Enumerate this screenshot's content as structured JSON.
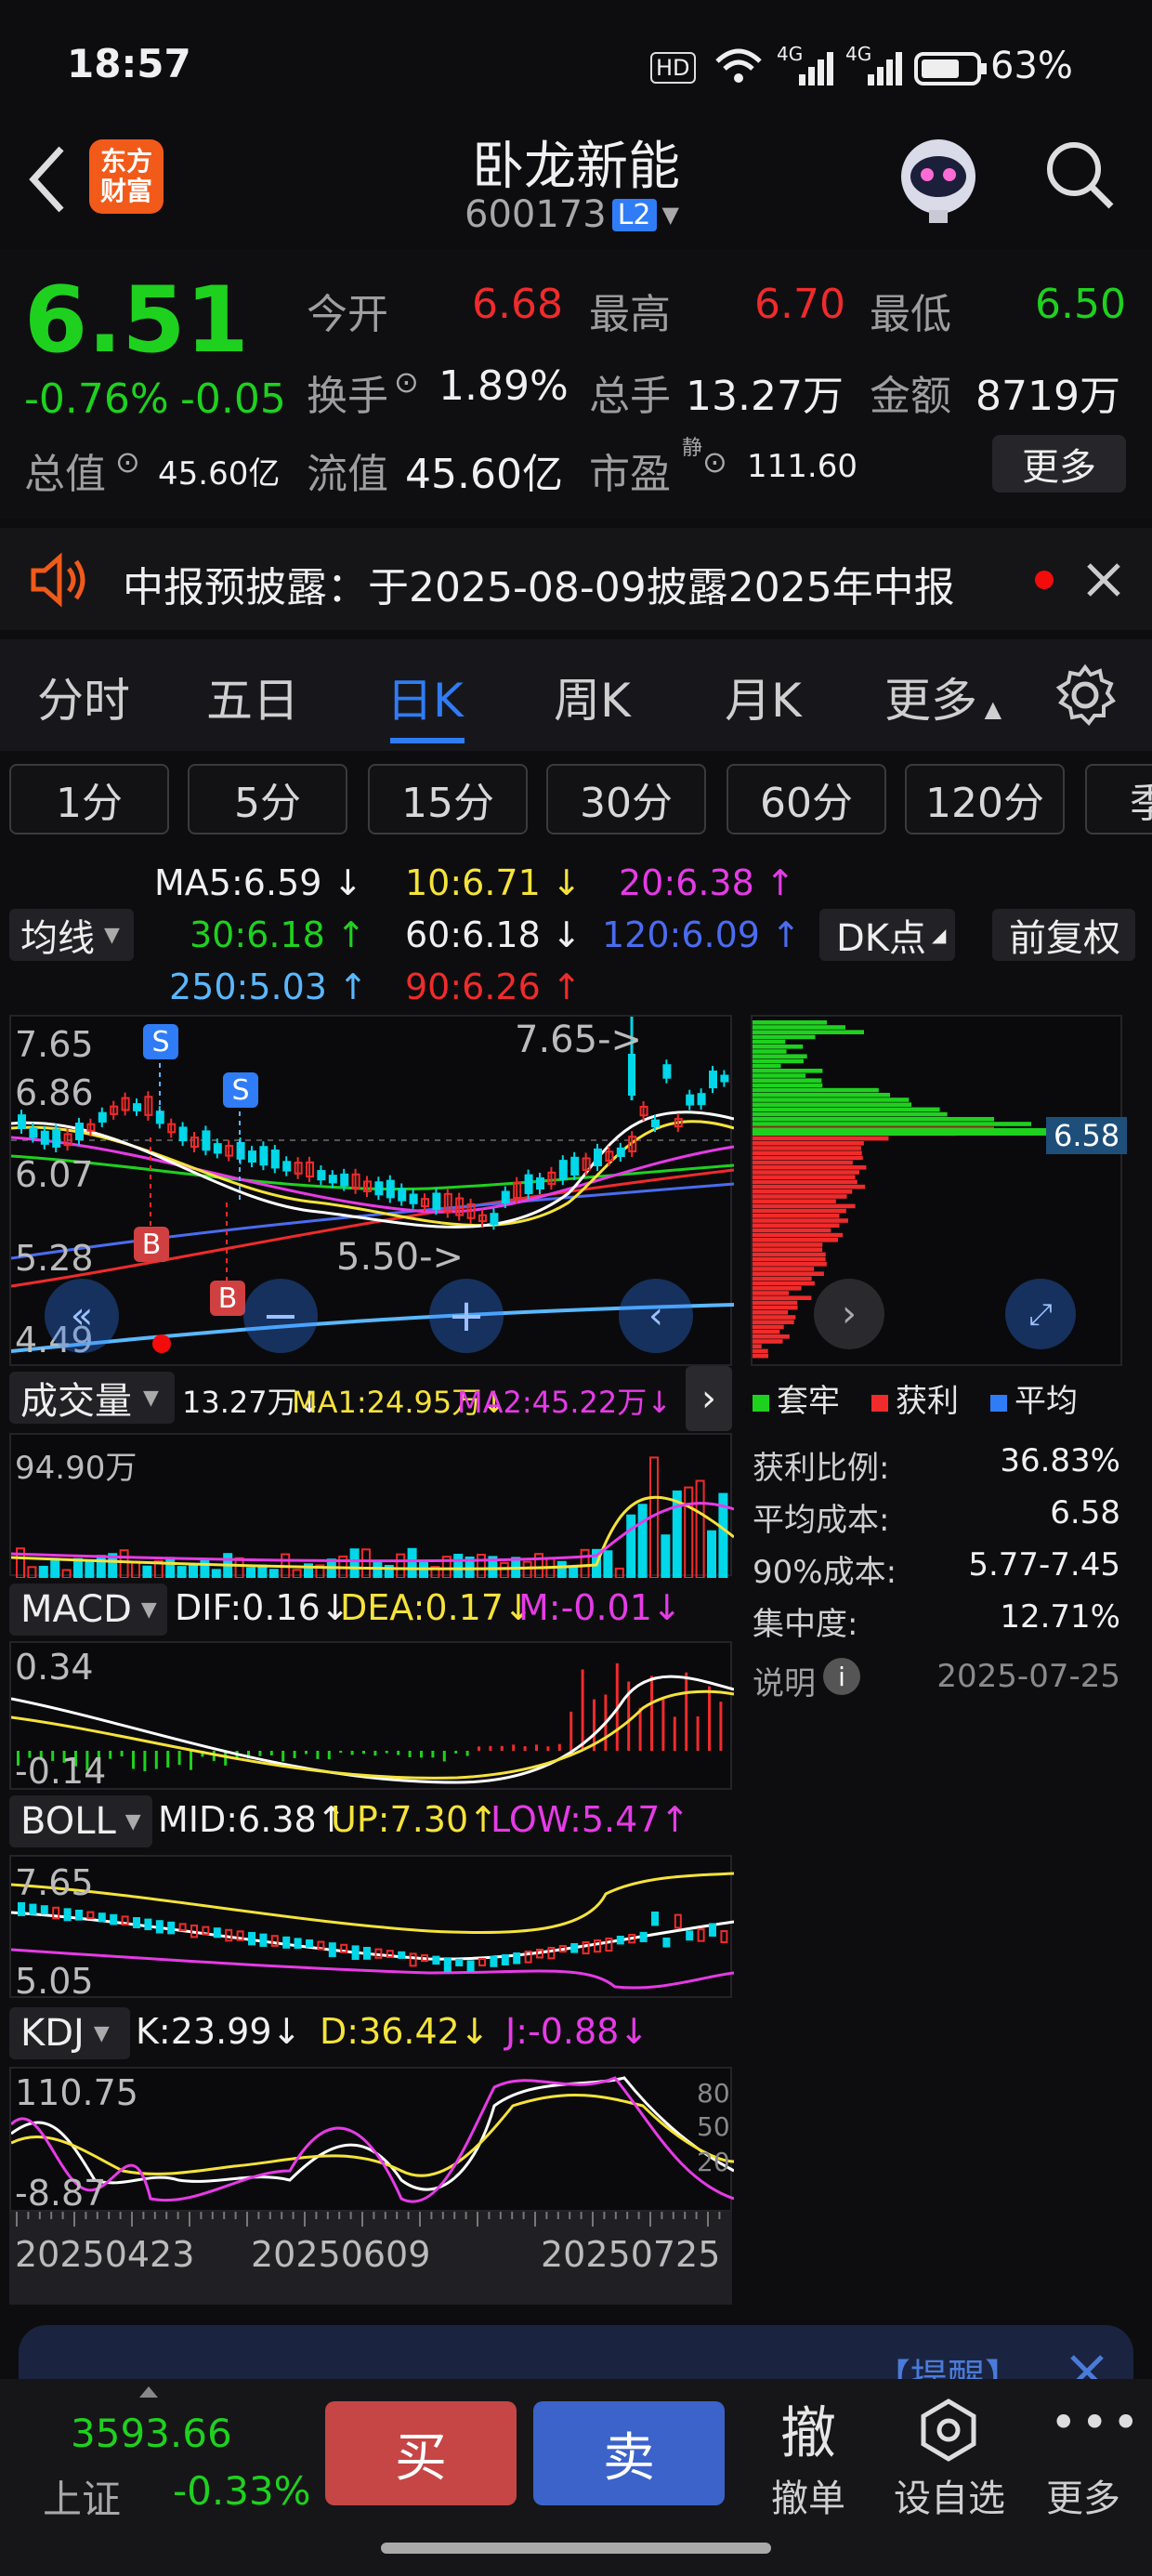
{
  "status_bar": {
    "time": "18:57",
    "hd": "HD",
    "net1": "4G",
    "net2": "4G",
    "battery": "63%"
  },
  "header": {
    "logo_line1": "东方",
    "logo_line2": "财富",
    "title": "卧龙新能",
    "code": "600173",
    "level": "L2"
  },
  "quote": {
    "price": "6.51",
    "change_pct": "-0.76%",
    "change": "-0.05",
    "open_label": "今开",
    "open": "6.68",
    "high_label": "最高",
    "high": "6.70",
    "low_label": "最低",
    "low": "6.50",
    "turnover_label": "换手",
    "turnover": "1.89%",
    "volume_label": "总手",
    "volume": "13.27万",
    "amount_label": "金额",
    "amount": "8719万",
    "mcap_label": "总值",
    "mcap": "45.60亿",
    "float_label": "流值",
    "float": "45.60亿",
    "pe_label": "市盈",
    "pe_sup": "静",
    "pe": "111.60",
    "more": "更多"
  },
  "notice": {
    "text": "中报预披露：于2025-08-09披露2025年中报"
  },
  "tabs": [
    "分时",
    "五日",
    "日K",
    "周K",
    "月K",
    "更多"
  ],
  "periods": [
    "1分",
    "5分",
    "15分",
    "30分",
    "60分",
    "120分",
    "季"
  ],
  "ma": {
    "label": "均线",
    "ma5": "MA5:6.59",
    "ma10": "10:6.71",
    "ma20": "20:6.38",
    "ma30": "30:6.18",
    "ma60": "60:6.18",
    "ma120": "120:6.09",
    "ma250": "250:5.03",
    "ma90": "90:6.26",
    "dk": "DK点",
    "adjust": "前复权"
  },
  "kline": {
    "y_top": "7.65",
    "y2": "6.86",
    "y3": "6.07",
    "y4": "5.28",
    "y_bot": "4.49",
    "max_note": "7.65->",
    "min_note": "5.50->",
    "s": "S",
    "b": "B"
  },
  "chips": {
    "price": "6.58",
    "legend_trapped": "套牢",
    "legend_profit": "获利",
    "legend_avg": "平均",
    "profit_ratio_label": "获利比例:",
    "profit_ratio": "36.83%",
    "avg_cost_label": "平均成本:",
    "avg_cost": "6.58",
    "cost90_label": "90%成本:",
    "cost90": "5.77-7.45",
    "concentration_label": "集中度:",
    "concentration": "12.71%",
    "explain": "说明",
    "date": "2025-07-25"
  },
  "volume": {
    "label": "成交量",
    "vol": "13.27万",
    "ma1": "MA1:24.95万",
    "ma2": "MA2:45.22万",
    "y_top": "94.90万"
  },
  "macd": {
    "label": "MACD",
    "dif": "DIF:0.16",
    "dea": "DEA:0.17",
    "m": "M:-0.01",
    "y_top": "0.34",
    "y_bot": "-0.14"
  },
  "boll": {
    "label": "BOLL",
    "mid": "MID:6.38",
    "up": "UP:7.30",
    "low": "LOW:5.47",
    "y_top": "7.65",
    "y_bot": "5.05"
  },
  "kdj": {
    "label": "KDJ",
    "k": "K:23.99",
    "d": "D:36.42",
    "j": "J:-0.88",
    "y_top": "110.75",
    "y_bot": "-8.87",
    "r80": "80",
    "r50": "50",
    "r20": "20"
  },
  "dates": [
    "20250423",
    "20250609",
    "20250725"
  ],
  "banner": {
    "text": "【提醒】"
  },
  "bottom": {
    "index_value": "3593.66",
    "index_name": "上证",
    "index_change": "-0.33%",
    "buy": "买",
    "sell": "卖",
    "cancel_icon": "撤",
    "cancel": "撤单",
    "watch": "设自选",
    "more": "更多"
  },
  "colors": {
    "up": "#f02b2b",
    "down": "#1fd11f",
    "accent": "#2f7cf6",
    "cyan": "#00d7e8",
    "yellow": "#f5e33b",
    "magenta": "#e63be6"
  }
}
